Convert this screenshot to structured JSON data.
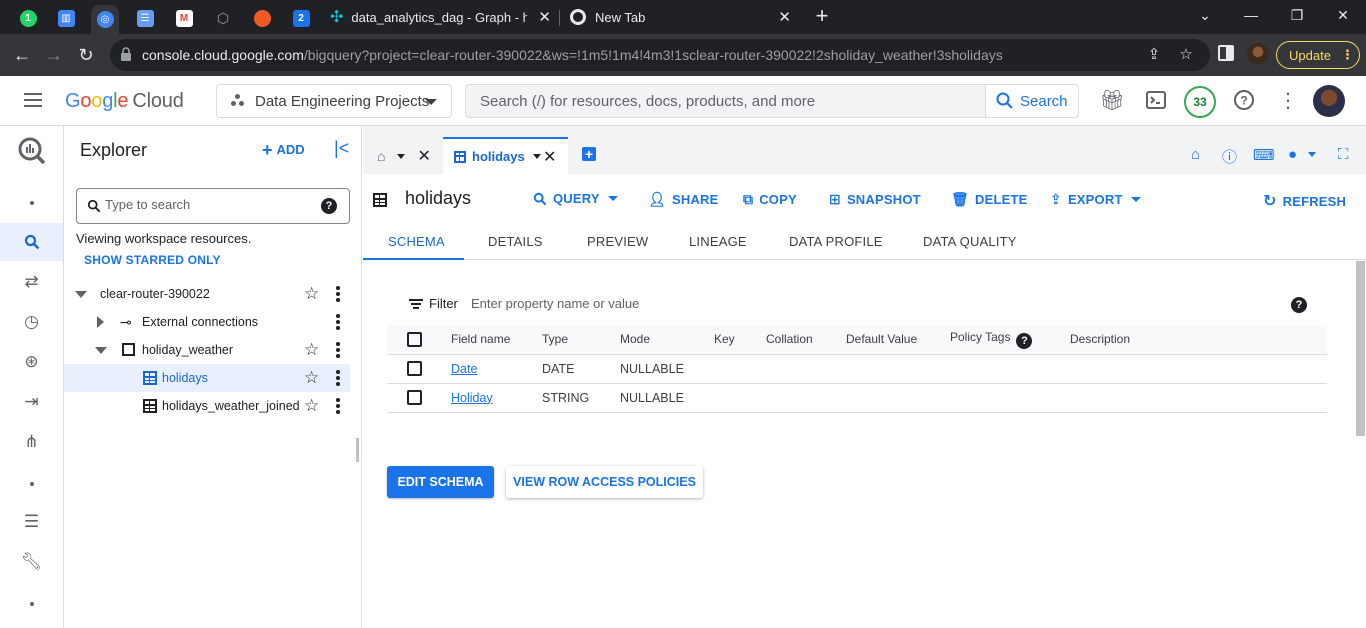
{
  "browser": {
    "tabs": [
      {
        "title": "data_analytics_dag - Graph - holi"
      },
      {
        "title": "New Tab"
      }
    ],
    "pinned_badges": {
      "whatsapp": "1",
      "num2": "2"
    },
    "url_host": "console.cloud.google.com",
    "url_path": "/bigquery?project=clear-router-390022&ws=!1m5!1m4!4m3!1sclear-router-390022!2sholiday_weather!3sholidays",
    "update_label": "Update"
  },
  "header": {
    "logo_google": "Google",
    "logo_cloud": "Cloud",
    "project": "Data Engineering Projects",
    "search_placeholder": "Search (/) for resources, docs, products, and more",
    "search_button": "Search",
    "notifications_count": "33"
  },
  "explorer": {
    "title": "Explorer",
    "add_label": "ADD",
    "search_placeholder": "Type to search",
    "viewing_text": "Viewing workspace resources.",
    "starred_link": "SHOW STARRED ONLY",
    "tree": {
      "project": "clear-router-390022",
      "external": "External connections",
      "dataset": "holiday_weather",
      "table1": "holidays",
      "table2": "holidays_weather_joined"
    }
  },
  "editor": {
    "active_tab": "holidays",
    "title": "holidays",
    "actions": {
      "query": "QUERY",
      "share": "SHARE",
      "copy": "COPY",
      "snapshot": "SNAPSHOT",
      "delete": "DELETE",
      "export": "EXPORT",
      "refresh": "REFRESH"
    },
    "subtabs": [
      "SCHEMA",
      "DETAILS",
      "PREVIEW",
      "LINEAGE",
      "DATA PROFILE",
      "DATA QUALITY"
    ],
    "filter_label": "Filter",
    "filter_placeholder": "Enter property name or value",
    "columns": [
      "Field name",
      "Type",
      "Mode",
      "Key",
      "Collation",
      "Default Value",
      "Policy Tags",
      "Description"
    ],
    "rows": [
      {
        "name": "Date",
        "type": "DATE",
        "mode": "NULLABLE"
      },
      {
        "name": "Holiday",
        "type": "STRING",
        "mode": "NULLABLE"
      }
    ],
    "edit_schema": "EDIT SCHEMA",
    "row_access": "VIEW ROW ACCESS POLICIES"
  },
  "colors": {
    "accent": "#1a73e8",
    "chrome_dark": "#202124",
    "selected_bg": "#e8f0fe"
  }
}
